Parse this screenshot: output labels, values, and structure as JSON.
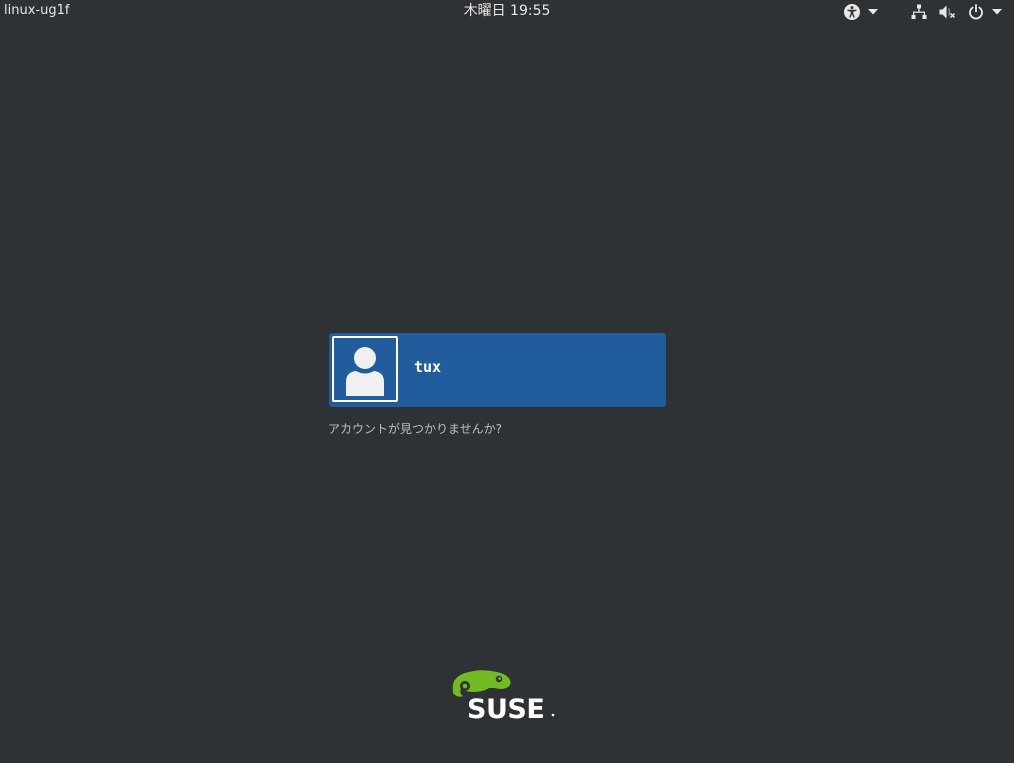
{
  "topbar": {
    "hostname": "linux-ug1f",
    "clock": "木曜日 19:55",
    "icons": [
      "accessibility-icon",
      "dropdown-arrow-icon",
      "network-wired-icon",
      "audio-muted-icon",
      "power-icon",
      "dropdown-arrow-icon"
    ]
  },
  "login": {
    "users": [
      {
        "name": "tux",
        "avatar": "default-user-avatar"
      }
    ],
    "not_listed_label": "アカウントが見つかりませんか?"
  },
  "branding": {
    "logo_text": "SUSE",
    "logo_color": "#73ba25",
    "selected_user_color": "#215d9c",
    "background_color": "#2e3235"
  }
}
